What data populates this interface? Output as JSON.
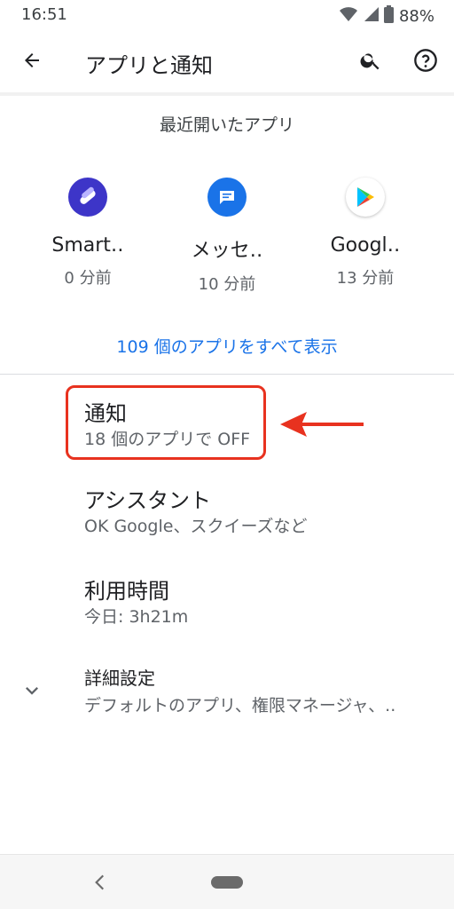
{
  "status_bar": {
    "time": "16:51",
    "battery_percent": "88%",
    "icons": [
      "wifi-icon",
      "signal-icon",
      "battery-icon"
    ]
  },
  "app_bar": {
    "title": "アプリと通知",
    "icons": [
      "back-arrow-icon",
      "search-icon",
      "help-icon"
    ]
  },
  "recent_apps": {
    "header": "最近開いたアプリ",
    "items": [
      {
        "name": "Smart‥",
        "time": "0 分前",
        "icon": "smart-launcher-icon",
        "icon_color": "#3d35c8"
      },
      {
        "name": "メッセ‥",
        "time": "10 分前",
        "icon": "messages-icon",
        "icon_color": "#1a73e8"
      },
      {
        "name": "Googl‥",
        "time": "13 分前",
        "icon": "google-play-icon",
        "icon_color": "#ffffff"
      }
    ],
    "see_all": "109 個のアプリをすべて表示"
  },
  "settings": {
    "items": [
      {
        "title": "通知",
        "subtitle": "18 個のアプリで OFF"
      },
      {
        "title": "アシスタント",
        "subtitle": "OK Google、スクイーズなど"
      },
      {
        "title": "利用時間",
        "subtitle": "今日: 3h21m"
      },
      {
        "title": "詳細設定",
        "subtitle": "デフォルトのアプリ、権限マネージャ、.."
      }
    ]
  },
  "annotation": {
    "color": "#e8321f"
  },
  "colors": {
    "accent": "#1a73e8",
    "primary_text": "#202124",
    "secondary_text": "#5f6368"
  }
}
